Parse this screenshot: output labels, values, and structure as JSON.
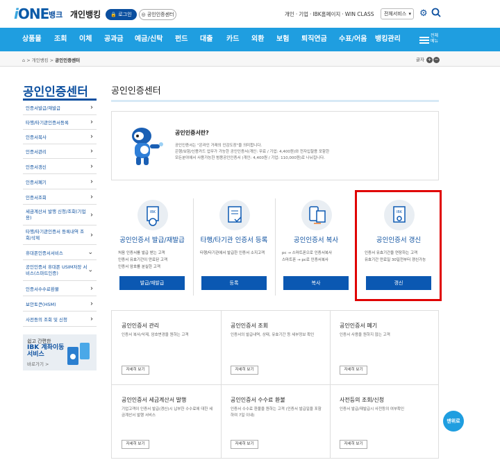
{
  "header": {
    "logo_i": "i",
    "logo_one": "ONE",
    "logo_bank": "뱅크",
    "title": "개인뱅킹",
    "login": "로그인",
    "cert_center": "공인인증센터",
    "top_links": [
      "개인",
      "기업",
      "IBK홈페이지",
      "WIN CLASS"
    ],
    "service_select": "전체서비스"
  },
  "nav": {
    "items": [
      "상품몰",
      "조회",
      "이체",
      "공과금",
      "예금/신탁",
      "펀드",
      "대출",
      "카드",
      "외환",
      "보험",
      "퇴직연금",
      "수표/어음",
      "뱅킹관리"
    ],
    "all_menu": "전체메뉴"
  },
  "breadcrumb": {
    "items": [
      "개인뱅킹",
      "공인인증센터"
    ],
    "font_label": "글자"
  },
  "sidebar": {
    "title": "공인인증센터",
    "items": [
      {
        "label": "인증서발급/재발급"
      },
      {
        "label": "타행/타기관인증서등록"
      },
      {
        "label": "인증서복사"
      },
      {
        "label": "인증서관리"
      },
      {
        "label": "인증서갱신"
      },
      {
        "label": "인증서폐기"
      },
      {
        "label": "인증서조회"
      },
      {
        "label": "세금계산서 발행 신청/조회(기업용)"
      },
      {
        "label": "타행/타기관인증서 등록내역 조회/삭제"
      },
      {
        "label": "휴대폰인증서서비스"
      },
      {
        "label": "공인인증서 휴대폰 USIM저장 서비스(스마트인증)"
      },
      {
        "label": "인증서수수료환불"
      },
      {
        "label": "보안토큰(HSM)"
      },
      {
        "label": "사전등의 조회 및 신청"
      }
    ],
    "banner": {
      "line1": "쉽고 간편한",
      "line2": "IBK 계좌이동 서비스",
      "more": "바로가기 >"
    }
  },
  "main": {
    "title": "공인인증센터",
    "intro": {
      "heading": "공인인증서란?",
      "p1": "공인인증서는 \"온라인 거래의 인감도장\"을 의미합니다.",
      "p2": "은행/보험/신용카드 업무가 가능한 공인인증서(개인: 무료 / 기업: 4,400원)와 전자입찰용 포함한",
      "p3": "모든분야에서 사용가능한 범용공인인증서 (개인: 4,400원 / 기업: 110,000원)로 나뉘집니다."
    },
    "cards": [
      {
        "title": "공인인증서 발급/재발급",
        "desc": [
          "처음 인증서를 발급 받는 고객",
          "인증서 유효기간이 만료된 고객",
          "인증서 암호를 분실한 고객"
        ],
        "button": "발급/재발급"
      },
      {
        "title": "타행/타기관 인증서 등록",
        "desc": [
          "타행/타기관에서 발급한 인증서 소지고객"
        ],
        "button": "등록"
      },
      {
        "title": "공인인증서 복사",
        "desc": [
          "pc → 스마트폰으로 인증서복사",
          "스마트폰 → pc로 인증서복사"
        ],
        "button": "복사"
      },
      {
        "title": "공인인증서 갱신",
        "desc": [
          "인증서 유효기간을 연장하는 고객",
          "유효기간 만료일 30일전부터 갱신가능"
        ],
        "button": "갱신"
      }
    ],
    "grid": [
      {
        "title": "공인인증서 관리",
        "desc": "인증서 복사/삭제, 암호변경을 원하는 고객",
        "btn": "자세히 보기"
      },
      {
        "title": "공인인증서 조회",
        "desc": "인증서의 발급내역, 상태, 유효기간 등 세부정보 확인",
        "btn": "자세히 보기"
      },
      {
        "title": "공인인증서 폐기",
        "desc": "인증서 사용을 원하지 않는 고객",
        "btn": "자세히 보기"
      },
      {
        "title": "공인인증서 세금계산서 발행",
        "desc": "기업고객이 인증서 발급(갱신)시 납부한 수수료에 대한 세금계산서 발행 서비스",
        "btn": "자세히 보기"
      },
      {
        "title": "공인인증서 수수료 환불",
        "desc": "인증서 수수료 환불을 원하는 고객 (인증서 발급일을 포함하여 7일 이내)",
        "btn": "자세히 보기"
      },
      {
        "title": "사전등의 조회/신청",
        "desc": "인증서 발급/재발급시 사전등의 여부확인",
        "btn": "자세히 보기"
      }
    ],
    "float_top": "맨위로"
  }
}
